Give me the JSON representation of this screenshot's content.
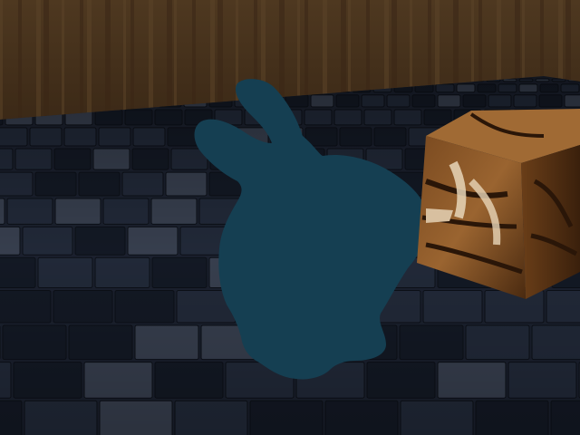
{
  "scene": {
    "description_free": true,
    "colors": {
      "wall_base": "#4a3520",
      "wall_stripe_dark": "#3a2716",
      "wall_stripe_light": "#5b4328",
      "floor_base": "#1c2230",
      "floor_tile_dark": "#141a26",
      "floor_tile_mid": "#232b3b",
      "floor_tile_light": "#3a4252",
      "floor_grout": "#0c1018",
      "bunny_fill": "#153f52",
      "cube_front": "#8a5a2a",
      "cube_side": "#5a3618",
      "cube_top": "#a06a34",
      "cube_stripe_dark": "#2a1608",
      "cube_fur_light": "#e8d6b8"
    },
    "objects": [
      {
        "name": "wooden-wall",
        "icon": "wood-texture"
      },
      {
        "name": "tiled-floor",
        "icon": "checker-texture"
      },
      {
        "name": "bunny-silhouette",
        "icon": "rabbit-shape"
      },
      {
        "name": "tiger-textured-cube",
        "icon": "cube-shape"
      }
    ]
  }
}
